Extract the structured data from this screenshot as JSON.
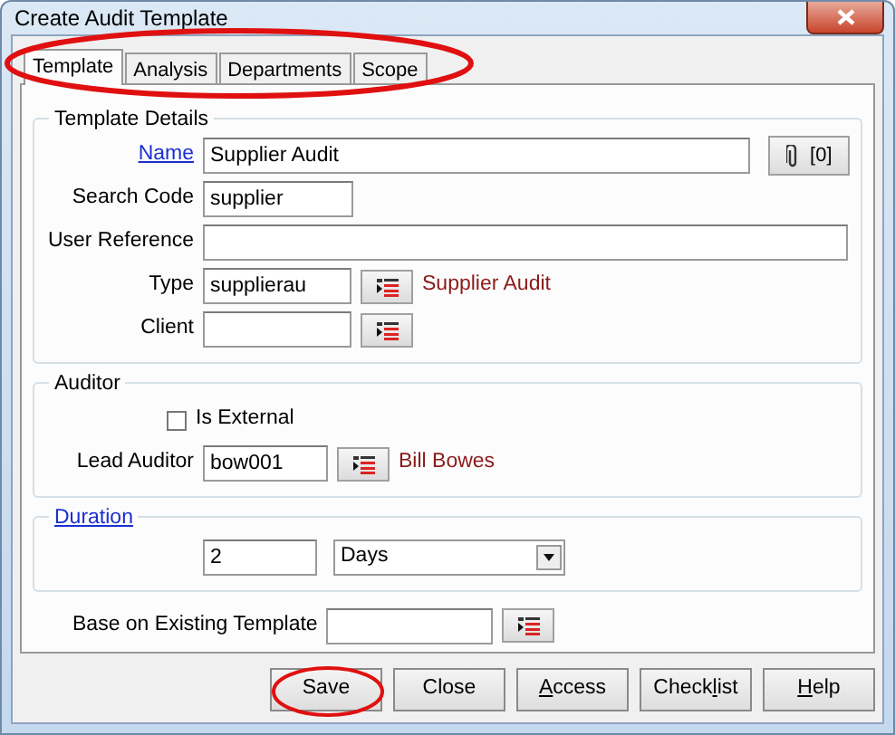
{
  "window": {
    "title": "Create Audit Template"
  },
  "tabs": [
    {
      "label": "Template",
      "selected": true
    },
    {
      "label": "Analysis",
      "selected": false
    },
    {
      "label": "Departments",
      "selected": false
    },
    {
      "label": "Scope",
      "selected": false
    }
  ],
  "tabs_highlighted": true,
  "template_details": {
    "title": "Template Details",
    "name": {
      "label": "Name",
      "link": true,
      "value": "Supplier Audit"
    },
    "attachments": {
      "count": "[0]"
    },
    "search_code": {
      "label": "Search Code",
      "value": "supplier"
    },
    "user_reference": {
      "label": "User Reference"
    },
    "type": {
      "label": "Type",
      "value": "supplierau",
      "description": "Supplier Audit"
    },
    "client": {
      "label": "Client"
    }
  },
  "auditor": {
    "title": "Auditor",
    "is_external": {
      "label": "Is External",
      "checked": false
    },
    "lead_auditor": {
      "label": "Lead Auditor",
      "value": "bow001",
      "description": "Bill Bowes"
    }
  },
  "duration": {
    "title": "Duration",
    "link": true,
    "value": "2",
    "unit": "Days"
  },
  "base_template": {
    "label": "Base on Existing Template"
  },
  "buttons": [
    {
      "label": "Save",
      "highlighted": true
    },
    {
      "label": "Close",
      "highlighted": false
    },
    {
      "mnemonic": "A",
      "after": "ccess",
      "highlighted": false
    },
    {
      "before": "Check",
      "mnemonic": "l",
      "after": "ist",
      "highlighted": false
    },
    {
      "mnemonic": "H",
      "after": "elp",
      "highlighted": false
    }
  ]
}
